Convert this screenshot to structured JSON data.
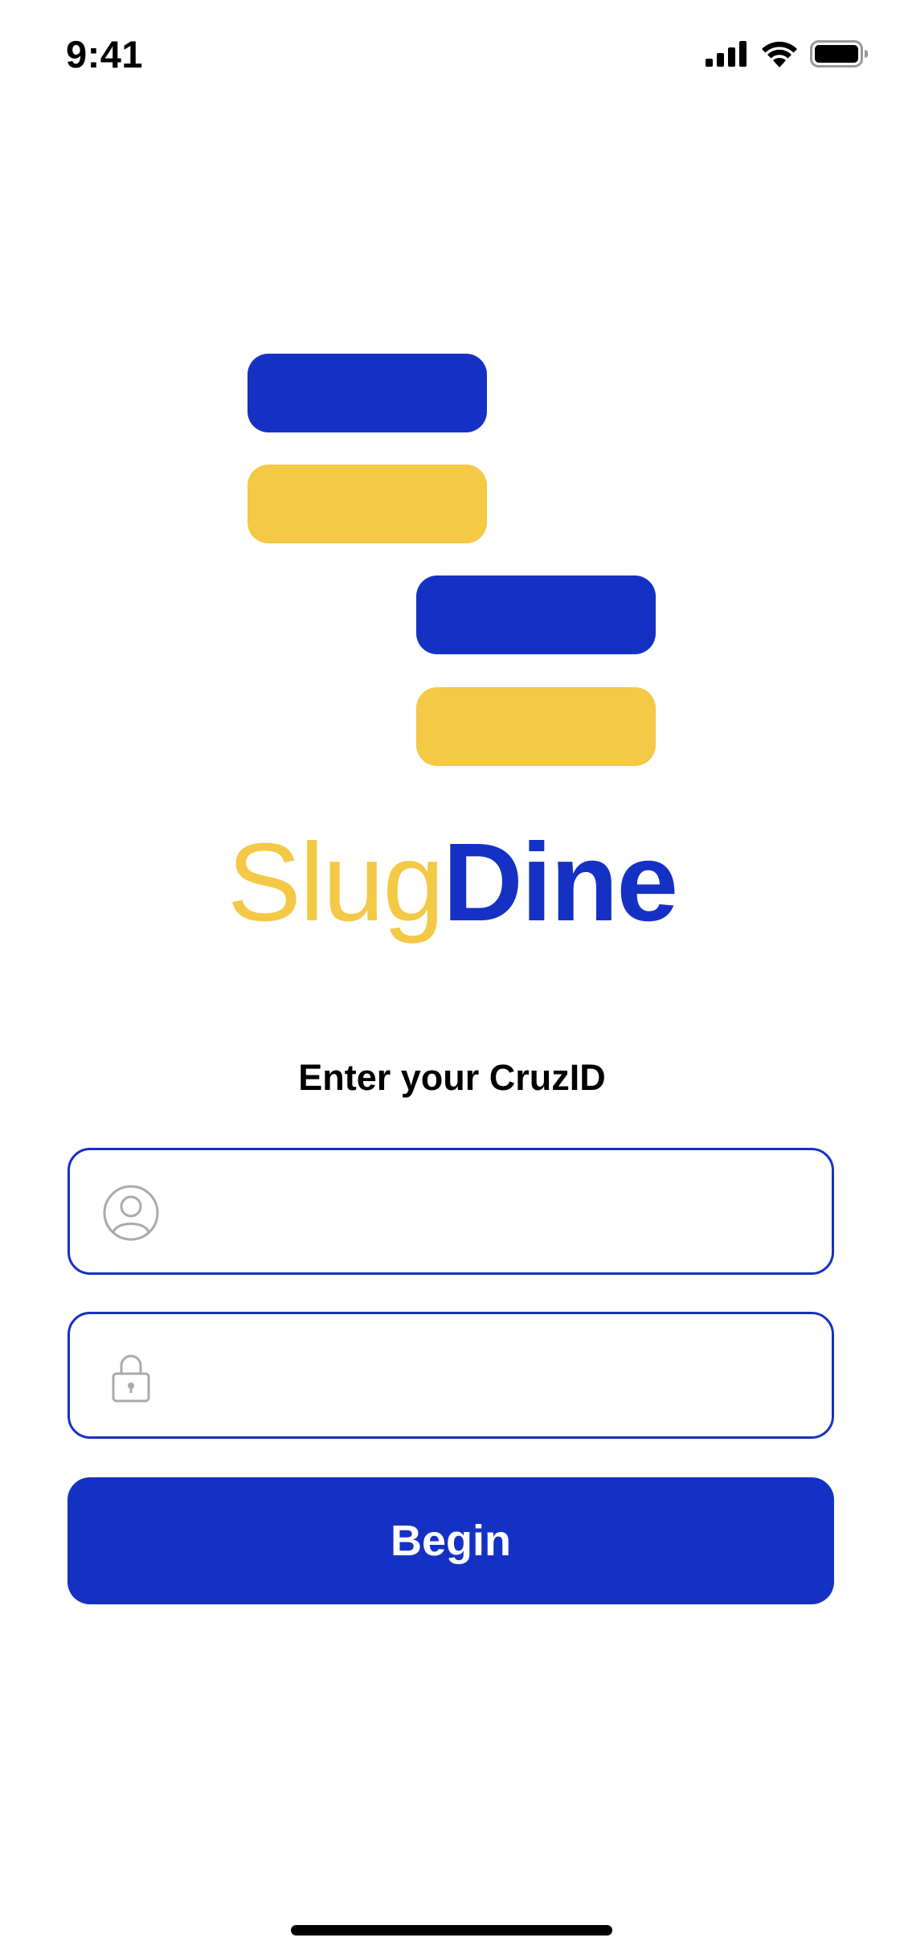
{
  "status_bar": {
    "time": "9:41"
  },
  "logo": {
    "word_part1": "Slug",
    "word_part2": "Dine",
    "colors": {
      "blue": "#1531C3",
      "yellow": "#F3C945"
    }
  },
  "login": {
    "prompt": "Enter your CruzID",
    "username": {
      "value": "",
      "icon": "user-icon"
    },
    "password": {
      "value": "",
      "icon": "lock-icon"
    },
    "submit_label": "Begin"
  }
}
